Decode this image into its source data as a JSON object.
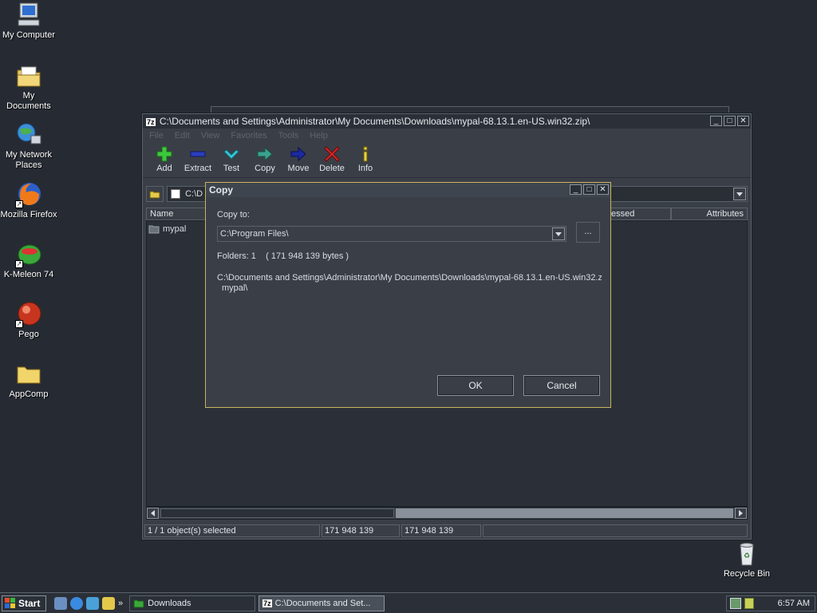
{
  "desktop": {
    "icons": [
      {
        "label": "My Computer"
      },
      {
        "label": "My Documents"
      },
      {
        "label": "My Network Places"
      },
      {
        "label": "Mozilla Firefox"
      },
      {
        "label": "K-Meleon 74"
      },
      {
        "label": "Pego"
      },
      {
        "label": "AppComp"
      },
      {
        "label": "Recycle Bin"
      }
    ]
  },
  "main_window": {
    "title": "C:\\Documents and Settings\\Administrator\\My Documents\\Downloads\\mypal-68.13.1.en-US.win32.zip\\",
    "app_badge": "7z",
    "menu": [
      "File",
      "Edit",
      "View",
      "Favorites",
      "Tools",
      "Help"
    ],
    "toolbar": [
      {
        "label": "Add",
        "icon": "plus-icon",
        "color": "#3cc93c"
      },
      {
        "label": "Extract",
        "icon": "minus-icon",
        "color": "#2a3fbf"
      },
      {
        "label": "Test",
        "icon": "check-icon",
        "color": "#39c7d6"
      },
      {
        "label": "Copy",
        "icon": "copy-arrow-icon",
        "color": "#3aa28e"
      },
      {
        "label": "Move",
        "icon": "move-arrow-icon",
        "color": "#1b2aa0"
      },
      {
        "label": "Delete",
        "icon": "x-icon",
        "color": "#d42a2a"
      },
      {
        "label": "Info",
        "icon": "info-icon",
        "color": "#e3d33a"
      }
    ],
    "address_fragment": "C:\\D",
    "columns": {
      "name": "Name",
      "compressed": "essed",
      "attributes": "Attributes"
    },
    "files": [
      {
        "name": "mypal"
      }
    ],
    "status": {
      "selected": "1 / 1 object(s) selected",
      "size": "171 948 139",
      "packed": "171 948 139"
    }
  },
  "copy_dialog": {
    "title": "Copy",
    "copy_to_label": "Copy to:",
    "copy_to_value": "C:\\Program Files\\",
    "browse_label": "...",
    "summary": "Folders: 1    ( 171 948 139 bytes )",
    "source_path": "C:\\Documents and Settings\\Administrator\\My Documents\\Downloads\\mypal-68.13.1.en-US.win32.zip",
    "source_item": "mypal\\",
    "ok_label": "OK",
    "cancel_label": "Cancel"
  },
  "taskbar": {
    "start_label": "Start",
    "tasks": [
      {
        "label": "Downloads"
      },
      {
        "label": "C:\\Documents and Set..."
      }
    ],
    "clock": "6:57 AM"
  }
}
